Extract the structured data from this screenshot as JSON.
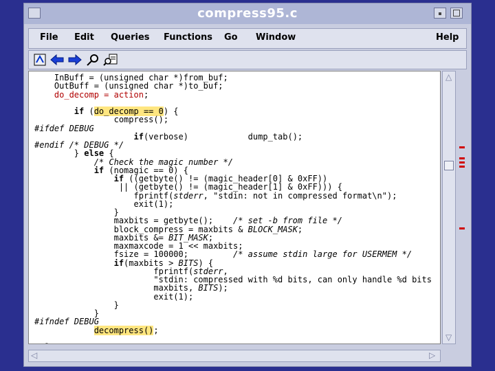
{
  "window": {
    "title": "compress95.c"
  },
  "menu": {
    "file": "File",
    "edit": "Edit",
    "queries": "Queries",
    "functions": "Functions",
    "go": "Go",
    "window": "Window",
    "help": "Help"
  },
  "toolbar": {
    "icons": [
      "home-icon",
      "back-arrow-icon",
      "forward-arrow-icon",
      "search-icon",
      "find-in-files-icon"
    ]
  },
  "code": {
    "lines": [
      "    InBuff = (unsigned char *)from_buf;",
      "    OutBuff = (unsigned char *)to_buf;",
      "    do_decomp = action;",
      "",
      "        if (do_decomp == 0) {",
      "                compress();",
      "#ifdef DEBUG",
      "                    if(verbose)            dump_tab();",
      "#endif /* DEBUG */",
      "        } else {",
      "            /* Check the magic number */",
      "            if (nomagic == 0) {",
      "                if ((getbyte() != (magic_header[0] & 0xFF))",
      "                 || (getbyte() != (magic_header[1] & 0xFF))) {",
      "                    fprintf(stderr, \"stdin: not in compressed format\\n\");",
      "                    exit(1);",
      "                }",
      "                maxbits = getbyte();    /* set -b from file */",
      "                block_compress = maxbits & BLOCK_MASK;",
      "                maxbits &= BIT_MASK;",
      "                maxmaxcode = 1 << maxbits;",
      "                fsize = 100000;         /* assume stdin large for USERMEM */",
      "                if(maxbits > BITS) {",
      "                        fprintf(stderr,",
      "                        \"stdin: compressed with %d bits, can only handle %d bits",
      "                        maxbits, BITS);",
      "                        exit(1);",
      "                }",
      "            }",
      "#ifndef DEBUG",
      "            decompress();",
      "",
      "#else"
    ]
  },
  "colors": {
    "highlight": "#ffe680",
    "marker": "#d00000",
    "desktop": "#2a2f8f"
  }
}
